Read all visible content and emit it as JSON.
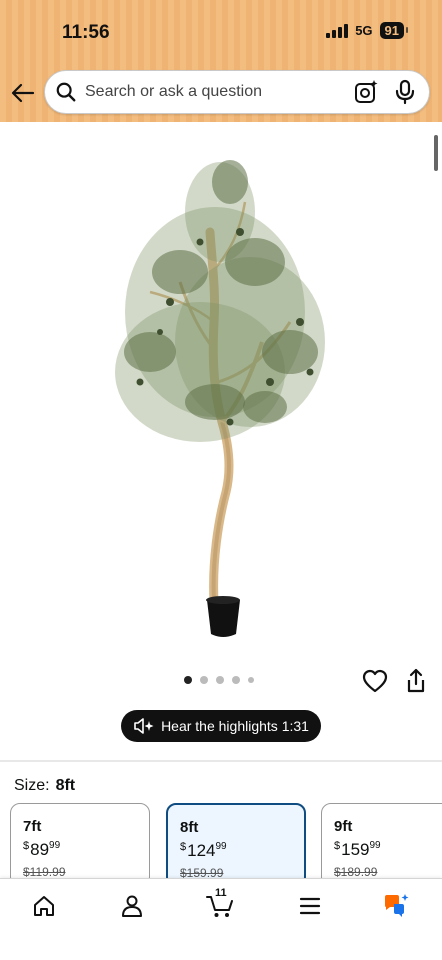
{
  "status_bar": {
    "time": "11:56",
    "network": "5G",
    "battery": "91"
  },
  "search": {
    "placeholder": "Search or ask a question"
  },
  "gallery": {
    "dots_total": 5,
    "active_index": 0
  },
  "audio": {
    "label": "Hear the highlights 1:31"
  },
  "size": {
    "label": "Size:",
    "selected": "8ft",
    "options": [
      {
        "size": "7ft",
        "currency": "$",
        "whole": "89",
        "fraction": "99",
        "was": "$119.99"
      },
      {
        "size": "8ft",
        "currency": "$",
        "whole": "124",
        "fraction": "99",
        "was": "$159.99"
      },
      {
        "size": "9ft",
        "currency": "$",
        "whole": "159",
        "fraction": "99",
        "was": "$189.99"
      }
    ]
  },
  "bottom_nav": {
    "cart_count": "11",
    "items": [
      "home-icon",
      "account-icon",
      "cart-icon",
      "menu-icon",
      "rufus-icon"
    ]
  },
  "colors": {
    "header_bg": "#f4bd80",
    "selected_border": "#0f4c81",
    "selected_bg": "#edf6ff",
    "assistant_orange": "#ff6a00",
    "assistant_blue": "#1a73e8"
  }
}
